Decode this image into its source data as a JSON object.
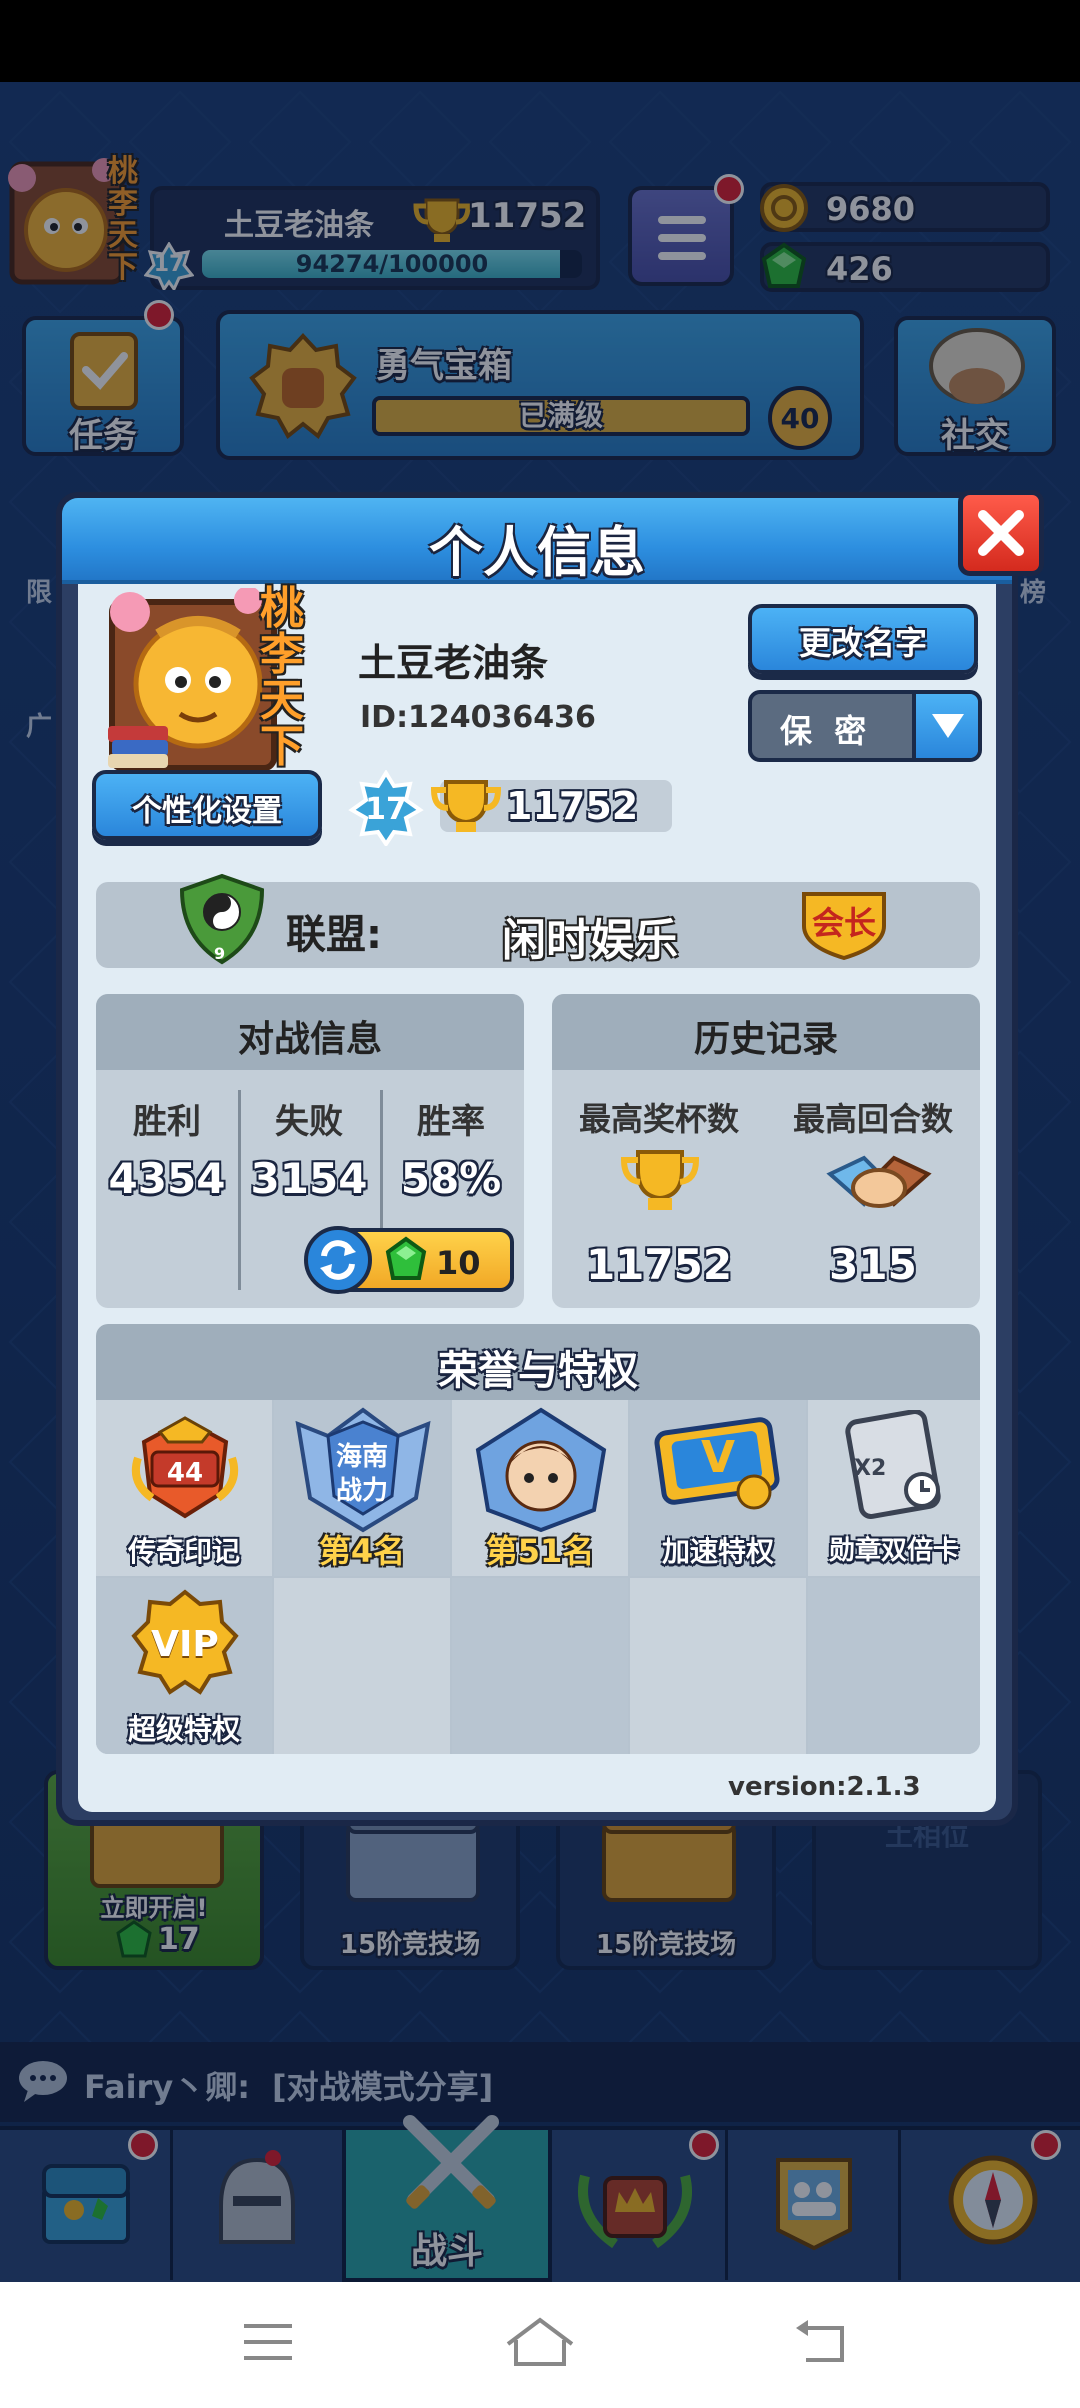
{
  "player": {
    "avatar_text": "桃李天下",
    "name": "土豆老油条",
    "level": "17",
    "trophies": "11752",
    "xp": "94274/100000",
    "xp_fraction": 0.94274
  },
  "currency": {
    "gold": "9680",
    "gems": "426"
  },
  "top_row": {
    "task_label": "任务",
    "chest_title": "勇气宝箱",
    "chest_status": "已满级",
    "chest_level": "40",
    "social_label": "社交"
  },
  "background": {
    "chest_open_label": "立即开启!",
    "chest_open_cost": "17",
    "arena_label_1": "15阶竞技场",
    "arena_label_2": "15阶竞技场",
    "chat_user": "Fairy丶卿:",
    "chat_msg": "[对战模式分享]",
    "left_frag_1": "限",
    "left_frag_2": "广",
    "right_frag": "榜",
    "right_frag_2": "土相位"
  },
  "modal": {
    "title": "个人信息",
    "rename_label": "更改名字",
    "privacy_label": "保  密",
    "personalize_label": "个性化设置",
    "id_text": "ID:124036436",
    "alliance_label": "联盟:",
    "alliance_name": "闲时娱乐",
    "alliance_level": "9",
    "alliance_role": "会长",
    "battle": {
      "title": "对战信息",
      "win_label": "胜利",
      "loss_label": "失败",
      "rate_label": "胜率",
      "wins": "4354",
      "losses": "3154",
      "rate": "58%",
      "reset_cost": "10"
    },
    "history": {
      "title": "历史记录",
      "max_trophy_label": "最高奖杯数",
      "max_round_label": "最高回合数",
      "max_trophy": "11752",
      "max_round": "315"
    },
    "honor": {
      "title": "荣誉与特权",
      "items": [
        {
          "label": "传奇印记",
          "badge": "44"
        },
        {
          "label": "海南战力",
          "sub": "第4名",
          "top1": "海南",
          "top2": "战力"
        },
        {
          "label": "第51名"
        },
        {
          "label": "加速特权",
          "badge": "V"
        },
        {
          "label": "勋章双倍卡",
          "badge": "X2"
        },
        {
          "label": "超级特权",
          "badge": "VIP"
        }
      ]
    },
    "version": "version:2.1.3"
  },
  "bottom_nav": {
    "battle_label": "战斗"
  },
  "colors": {
    "accent_blue": "#2d8fe0",
    "gold": "#f5b824",
    "gem_green": "#2fbf3b",
    "notify_red": "#e02030"
  }
}
